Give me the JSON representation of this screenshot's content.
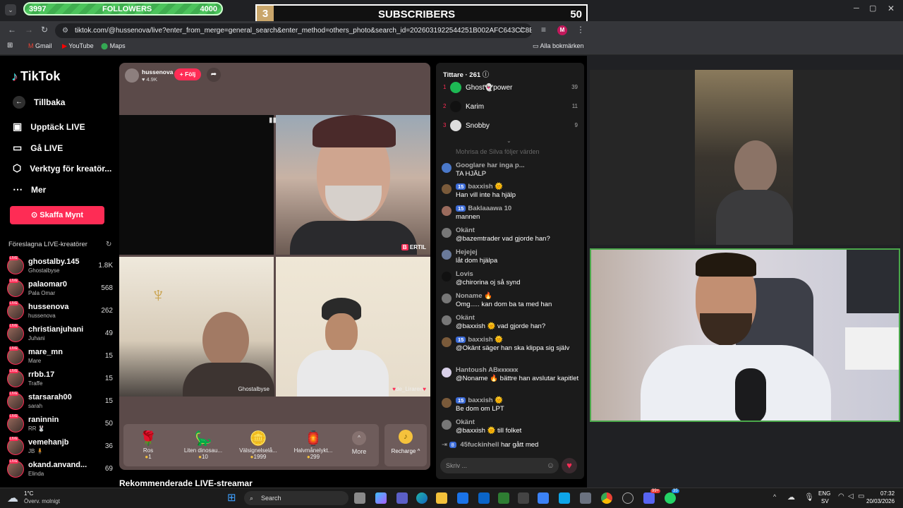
{
  "overlay": {
    "followers": {
      "min": "3997",
      "label": "FOLLOWERS",
      "max": "4000",
      "progress": 0.0
    },
    "subscribers": {
      "index": "3",
      "label": "SUBSCRIBERS",
      "count": "50"
    }
  },
  "browser": {
    "url": "tiktok.com/@hussenova/live?enter_from_merge=general_search&enter_method=others_photo&search_id=2026031922544251B002AFC643CC8EC0E...",
    "bookmarks": [
      "Gmail",
      "YouTube",
      "Maps"
    ],
    "all_bookmarks": "Alla bokmärken",
    "profile_initial": "M"
  },
  "sidebar": {
    "logo": "TikTok",
    "back": "Tillbaka",
    "nav": [
      "Upptäck LIVE",
      "Gå LIVE",
      "Verktyg för kreatör...",
      "Mer"
    ],
    "coins_button": "Skaffa Mynt",
    "suggested_title": "Föreslagna LIVE-kreatörer",
    "live_badge": "LIVE",
    "creators": [
      {
        "name": "ghostalby.145",
        "sub": "Ghostalbyse",
        "count": "1.8K"
      },
      {
        "name": "palaomar0",
        "sub": "Pala Omar",
        "count": "568"
      },
      {
        "name": "hussenova",
        "sub": "hussenova",
        "count": "262"
      },
      {
        "name": "christianjuhani",
        "sub": "Juhani",
        "count": "49"
      },
      {
        "name": "mare_mn",
        "sub": "Mare",
        "count": "15"
      },
      {
        "name": "rrbb.17",
        "sub": "Traffe",
        "count": "15"
      },
      {
        "name": "starsarah00",
        "sub": "sarah",
        "count": "15"
      },
      {
        "name": "raninnin",
        "sub": "RR 🐰",
        "count": "50"
      },
      {
        "name": "vemehanjb",
        "sub": "JB 🧍",
        "count": "36"
      },
      {
        "name": "okand.anvand...",
        "sub": "Elinda",
        "count": "69"
      }
    ]
  },
  "stream": {
    "host": "hussenova",
    "host_likes": "♥ 4.9K",
    "follow_button": "+ Följ",
    "tiles": [
      "ERTIL",
      "Ghostalbyse",
      "de_Liraren"
    ],
    "gifts": [
      {
        "name": "Ros",
        "price": "1",
        "icon": "🌹"
      },
      {
        "name": "Liten dinosau...",
        "price": "10",
        "icon": "🦕"
      },
      {
        "name": "Välsignelselå...",
        "price": "1999",
        "icon": "🪙"
      },
      {
        "name": "Halvmånelykt...",
        "price": "299",
        "icon": "🏮"
      }
    ],
    "more": "More",
    "recharge": "Recharge ^",
    "recommended": "Rekommenderade LIVE-streamar"
  },
  "chat": {
    "viewers_label": "Tittare · 261",
    "ranking": [
      {
        "rank": "1",
        "name": "Ghost👻power",
        "score": "39"
      },
      {
        "rank": "2",
        "name": "Karim",
        "score": "11"
      },
      {
        "rank": "3",
        "name": "Snobby",
        "score": "9"
      }
    ],
    "faded": "Mohrisa de Silva  följer värden",
    "messages": [
      {
        "name": "Googlare har inga p...",
        "level": "",
        "text": "TA HJÄLP"
      },
      {
        "name": "baxxish 🌞",
        "level": "15",
        "text": "Han vill inte ha hjälp"
      },
      {
        "name": "Baklaaawa 10",
        "level": "15",
        "text": "mannen"
      },
      {
        "name": "Okänt",
        "level": "",
        "text": "@bazemtrader vad gjorde han?"
      },
      {
        "name": "Hejejej",
        "level": "",
        "text": "låt dom hjälpa"
      },
      {
        "name": "Lovis",
        "level": "",
        "text": "@chirorina oj så synd"
      },
      {
        "name": "Noname 🔥",
        "level": "",
        "text": "Omg..... kan dom ba ta med han"
      },
      {
        "name": "Okänt",
        "level": "",
        "text": "@baxxish 🌞 vad gjorde han?"
      },
      {
        "name": "baxxish 🌞",
        "level": "15",
        "text": "@Okänt säger han ska klippa sig själv"
      },
      {
        "name": "Hantoush ABкккккк",
        "level": "",
        "text": "@Noname 🔥 bättre han avslutar kapitlet"
      },
      {
        "name": "baxxish 🌞",
        "level": "15",
        "text": "Be dom om LPT"
      },
      {
        "name": "Okänt",
        "level": "",
        "text": "@baxxish 🌞 till folket"
      }
    ],
    "join": {
      "level": "8",
      "name": "45fuckinhell",
      "text": "har gått med"
    },
    "input_placeholder": "Skriv ..."
  },
  "taskbar": {
    "weather_temp": "1°C",
    "weather_desc": "Överv. molnigt",
    "search": "Search",
    "lang": "ENG",
    "lang2": "SV",
    "time": "07:32",
    "date": "20/03/2026",
    "badge_a": "99+",
    "badge_b": "35"
  }
}
